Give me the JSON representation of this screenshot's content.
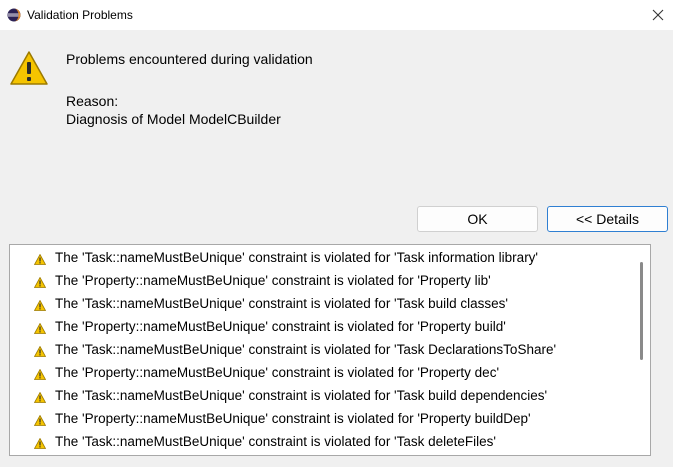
{
  "window": {
    "title": "Validation Problems"
  },
  "dialog": {
    "message": "Problems encountered during validation",
    "reason_label": "Reason:",
    "reason_text": "Diagnosis of Model ModelCBuilder"
  },
  "buttons": {
    "ok": "OK",
    "details": "<< Details"
  },
  "problems": [
    "The 'Task::nameMustBeUnique' constraint is violated for 'Task information library'",
    "The 'Property::nameMustBeUnique' constraint is violated for 'Property lib'",
    "The 'Task::nameMustBeUnique' constraint is violated for 'Task build classes'",
    "The 'Property::nameMustBeUnique' constraint is violated for 'Property build'",
    "The 'Task::nameMustBeUnique' constraint is violated for 'Task DeclarationsToShare'",
    "The 'Property::nameMustBeUnique' constraint is violated for 'Property dec'",
    "The 'Task::nameMustBeUnique' constraint is violated for 'Task build dependencies'",
    "The 'Property::nameMustBeUnique' constraint is violated for 'Property buildDep'",
    "The 'Task::nameMustBeUnique' constraint is violated for 'Task deleteFiles'"
  ],
  "icons": {
    "app": "eclipse-icon",
    "close": "close-icon",
    "dialog": "warning-icon",
    "item": "warning-small-icon"
  },
  "colors": {
    "warning_fill": "#f5c400",
    "focus_border": "#2f7fd2"
  }
}
